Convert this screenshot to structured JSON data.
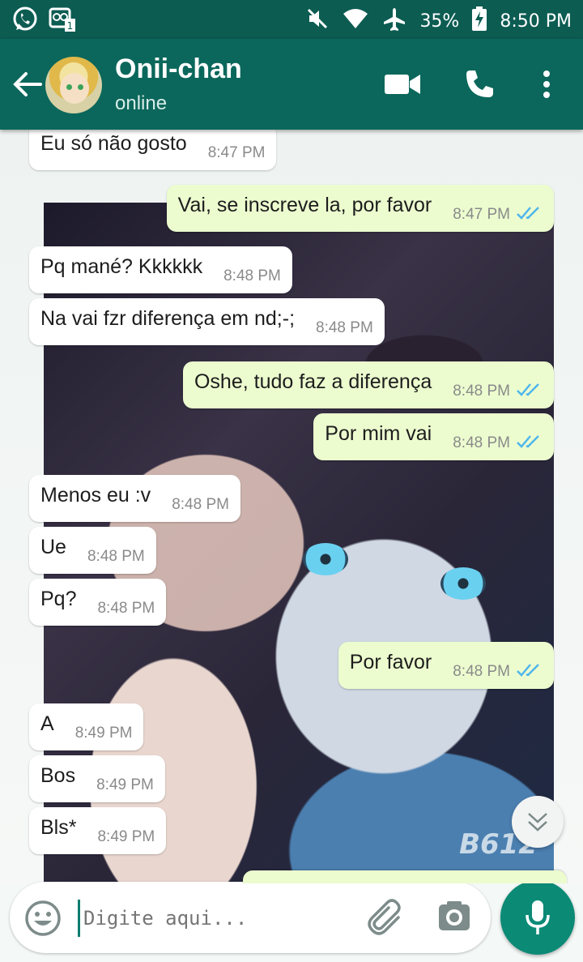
{
  "status_bar": {
    "battery": "35%",
    "time": "8:50 PM",
    "icons": [
      "whatsapp-icon",
      "voicemail-notification-icon",
      "mute-icon",
      "wifi-icon",
      "airplane-icon",
      "battery-charging-icon"
    ]
  },
  "header": {
    "contact_name": "Onii-chan",
    "presence": "online",
    "icons": [
      "back-arrow-icon",
      "video-call-icon",
      "phone-icon",
      "more-options-icon"
    ]
  },
  "messages": [
    {
      "direction": "in",
      "text": "Eu só não gosto",
      "time": "8:47 PM"
    },
    {
      "direction": "out",
      "text": "Vai, se inscreve la, por favor",
      "time": "8:47 PM",
      "read": true
    },
    {
      "direction": "in",
      "text": "Pq mané? Kkkkkk",
      "time": "8:48 PM"
    },
    {
      "direction": "in",
      "text": "Na vai fzr diferença em nd;-;",
      "time": "8:48 PM"
    },
    {
      "direction": "out",
      "text": "Oshe, tudo faz a diferença",
      "time": "8:48 PM",
      "read": true
    },
    {
      "direction": "out",
      "text": "Por mim vai",
      "time": "8:48 PM",
      "read": true
    },
    {
      "direction": "in",
      "text": "Menos eu :v",
      "time": "8:48 PM"
    },
    {
      "direction": "in",
      "text": "Ue",
      "time": "8:48 PM"
    },
    {
      "direction": "in",
      "text": "Pq?",
      "time": "8:48 PM"
    },
    {
      "direction": "out",
      "text": "Por favor",
      "time": "8:48 PM",
      "read": true
    },
    {
      "direction": "in",
      "text": "A",
      "time": "8:49 PM"
    },
    {
      "direction": "in",
      "text": "Bos",
      "time": "8:49 PM"
    },
    {
      "direction": "in",
      "text": "Bls*",
      "time": "8:49 PM"
    }
  ],
  "wallpaper": {
    "watermark": "B612"
  },
  "composer": {
    "placeholder": "Digite aqui...",
    "icons": [
      "emoji-icon",
      "attach-icon",
      "camera-icon",
      "mic-icon"
    ]
  },
  "colors": {
    "header": "#0b675b",
    "status_bar": "#0c5c52",
    "outgoing_bubble": "#ecfccf",
    "incoming_bubble": "#ffffff",
    "read_ticks": "#4fb6ec",
    "fab": "#0b8a76"
  }
}
